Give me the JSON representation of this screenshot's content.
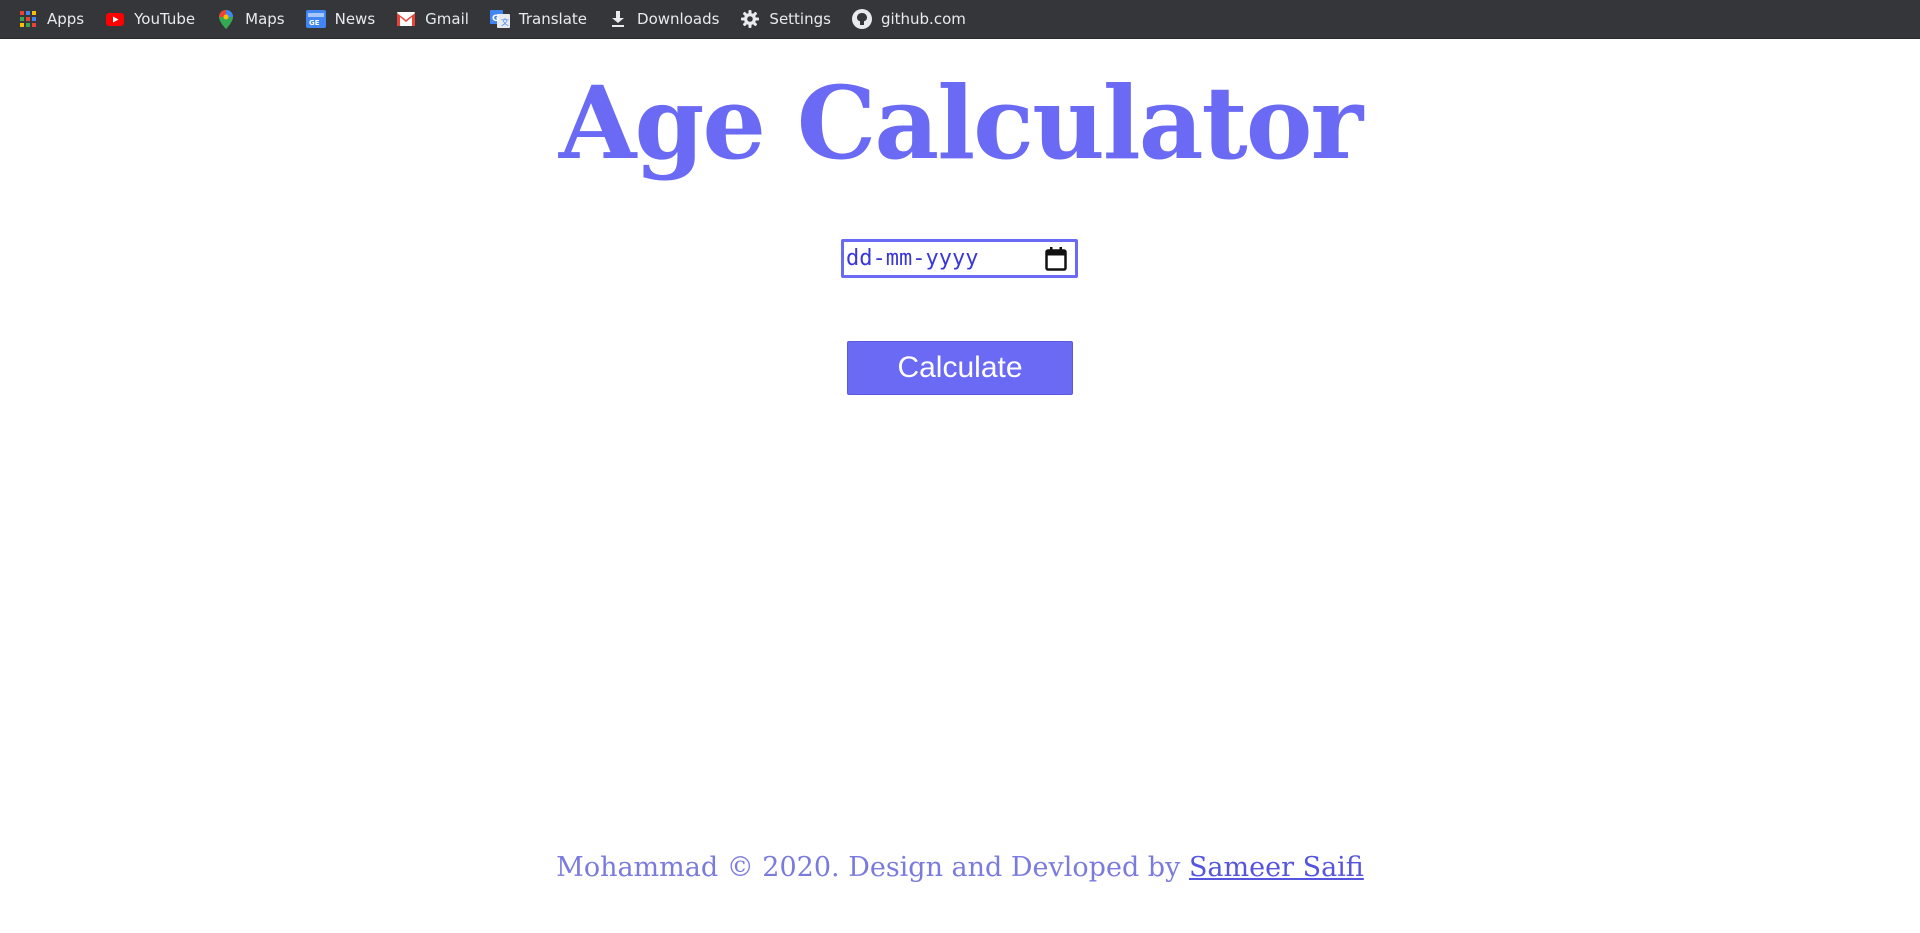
{
  "bookmarks": [
    {
      "label": "Apps",
      "icon": "apps-grid-icon"
    },
    {
      "label": "YouTube",
      "icon": "youtube-icon"
    },
    {
      "label": "Maps",
      "icon": "maps-pin-icon"
    },
    {
      "label": "News",
      "icon": "news-icon"
    },
    {
      "label": "Gmail",
      "icon": "gmail-icon"
    },
    {
      "label": "Translate",
      "icon": "translate-icon"
    },
    {
      "label": "Downloads",
      "icon": "download-icon"
    },
    {
      "label": "Settings",
      "icon": "gear-icon"
    },
    {
      "label": "github.com",
      "icon": "github-icon"
    }
  ],
  "page": {
    "title": "Age Calculator",
    "date_placeholder": "dd-mm-yyyy",
    "calculate_label": "Calculate"
  },
  "footer": {
    "text": "Mohammad © 2020. Design and Devloped by ",
    "link_label": "Sameer Saifi"
  },
  "colors": {
    "accent": "#6a6af4",
    "bookmarks_bar": "#35363a",
    "footer_text": "#7b7bde"
  }
}
